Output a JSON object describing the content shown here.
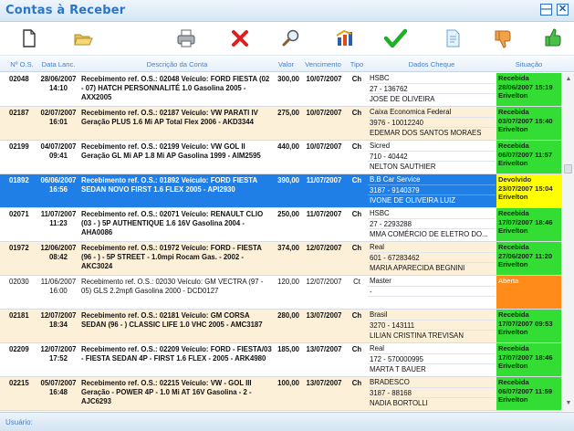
{
  "window": {
    "title": "Contas à Receber",
    "minimize": "—",
    "close": "✕"
  },
  "toolbar": [
    {
      "name": "new-document-icon"
    },
    {
      "name": "open-folder-icon"
    },
    {
      "name": "printer-icon"
    },
    {
      "name": "delete-x-icon"
    },
    {
      "name": "search-magnifier-icon"
    },
    {
      "name": "report-icon"
    },
    {
      "name": "checkmark-icon"
    },
    {
      "name": "notes-icon"
    },
    {
      "name": "thumbs-down-icon"
    },
    {
      "name": "thumbs-up-icon"
    }
  ],
  "columns": {
    "os": "Nº O.S.",
    "date": "Data Lanc.",
    "desc": "Descrição da Conta",
    "val": "Valor",
    "venc": "Vencimento",
    "tipo": "Tipo",
    "cheque": "Dados Cheque",
    "situ": "Situação"
  },
  "colors": {
    "white": "#ffffff",
    "beige": "#fdf0d8",
    "selected": "#1f7fe6",
    "green": "#33dd33",
    "yellow": "#ffff00",
    "orange": "#ff8c1a"
  },
  "rows": [
    {
      "os": "02048",
      "date": "28/06/2007\n14:10",
      "desc": "Recebimento ref. O.S.: 02048 Veículo: FORD FIESTA (02 - 07) HATCH PERSONNALITÉ 1.0 Gasolina 2005 - AXX2005",
      "val": "300,00",
      "venc": "10/07/2007",
      "tipo": "Ch",
      "bank": "HSBC",
      "cheque": "27 - 136762",
      "holder": "JOSE DE OLIVEIRA",
      "situ": "Recebida\n28/06/2007 15:19\nErivelton",
      "bg": "white",
      "situColor": "green",
      "bold": true
    },
    {
      "os": "02187",
      "date": "02/07/2007\n16:01",
      "desc": "Recebimento ref. O.S.: 02187 Veículo: VW PARATI IV Geração PLUS 1.6 Mi AP Total Flex 2006 - AKD3344",
      "val": "275,00",
      "venc": "10/07/2007",
      "tipo": "Ch",
      "bank": "Caixa Economica Federal",
      "cheque": "3976 - 10012240",
      "holder": "EDEMAR DOS SANTOS MORAES",
      "situ": "Recebida\n03/07/2007 15:40\nErivelton",
      "bg": "beige",
      "situColor": "green",
      "bold": true
    },
    {
      "os": "02199",
      "date": "04/07/2007\n09:41",
      "desc": "Recebimento ref. O.S.: 02199 Veículo: VW GOL II Geração GL Mi AP 1.8 Mi AP Gasolina 1999 - AIM2595",
      "val": "440,00",
      "venc": "10/07/2007",
      "tipo": "Ch",
      "bank": "Sicred",
      "cheque": "710 - 40442",
      "holder": "NELTON SAUTHIER",
      "situ": "Recebida\n06/07/2007 11:57\nErivelton",
      "bg": "white",
      "situColor": "green",
      "bold": true
    },
    {
      "os": "01892",
      "date": "06/06/2007\n16:56",
      "desc": "Recebimento ref. O.S.: 01892 Veículo: FORD FIESTA SEDAN NOVO FIRST 1.6 FLEX 2005 - API2930",
      "val": "390,00",
      "venc": "11/07/2007",
      "tipo": "Ch",
      "bank": "B.B Car Service",
      "cheque": "3187 - 9140379",
      "holder": "IVONE DE OLIVEIRA LUIZ",
      "situ": "Devolvido\n23/07/2007 15:04\nErivelton",
      "bg": "selected",
      "situColor": "yellow",
      "bold": true
    },
    {
      "os": "02071",
      "date": "11/07/2007\n11:23",
      "desc": "Recebimento ref. O.S.: 02071 Veículo: RENAULT CLIO (03 - ) 5P AUTHENTIQUE 1.6 16V Gasolina 2004 - AHA0086",
      "val": "250,00",
      "venc": "11/07/2007",
      "tipo": "Ch",
      "bank": "HSBC",
      "cheque": "27 - 2293288",
      "holder": "MMA COMÉRCIO DE ELETRO DO...",
      "situ": "Recebida\n17/07/2007 18:46\nErivelton",
      "bg": "white",
      "situColor": "green",
      "bold": true
    },
    {
      "os": "01972",
      "date": "12/06/2007\n08:42",
      "desc": "Recebimento ref. O.S.: 01972 Veículo: FORD - FIESTA (96 - ) - 5P STREET - 1.0mpi Rocam Gas. - 2002 - AKC3024",
      "val": "374,00",
      "venc": "12/07/2007",
      "tipo": "Ch",
      "bank": "Real",
      "cheque": "601 - 67283462",
      "holder": "MARIA APARECIDA BEGNINI",
      "situ": "Recebida\n27/06/2007 11:20\nErivelton",
      "bg": "beige",
      "situColor": "green",
      "bold": true
    },
    {
      "os": "02030",
      "date": "11/06/2007\n16:00",
      "desc": "Recebimento ref. O.S.: 02030 Veículo: GM VECTRA (97 - 05) GLS 2.2mpfi Gasolina 2000 - DCD0127",
      "val": "120,00",
      "venc": "12/07/2007",
      "tipo": "Ct",
      "bank": "Master",
      "cheque": "-",
      "holder": "",
      "situ": "Aberta",
      "bg": "white",
      "situColor": "orange",
      "bold": false
    },
    {
      "os": "02181",
      "date": "12/07/2007\n18:34",
      "desc": "Recebimento ref. O.S.: 02181 Veículo: GM CORSA SEDAN (96 - ) CLASSIC LIFE 1.0 VHC 2005 - AMC3187",
      "val": "280,00",
      "venc": "13/07/2007",
      "tipo": "Ch",
      "bank": "Brasil",
      "cheque": "3270 - 143111",
      "holder": "LILIAN CRISTINA TREVISAN",
      "situ": "Recebida\n17/07/2007 09:53\nErivelton",
      "bg": "beige",
      "situColor": "green",
      "bold": true
    },
    {
      "os": "02209",
      "date": "12/07/2007\n17:52",
      "desc": "Recebimento ref. O.S.: 02209 Veículo: FORD - FIESTA/03 - FIESTA SEDAN 4P - FIRST 1.6 FLEX - 2005 - ARK4980",
      "val": "185,00",
      "venc": "13/07/2007",
      "tipo": "Ch",
      "bank": "Real",
      "cheque": "172 - 570000995",
      "holder": "MARTA T BAUER",
      "situ": "Recebida\n17/07/2007 18:46\nErivelton",
      "bg": "white",
      "situColor": "green",
      "bold": true
    },
    {
      "os": "02215",
      "date": "05/07/2007\n16:48",
      "desc": "Recebimento ref. O.S.: 02215 Veículo: VW - GOL III Geração - POWER 4P - 1.0 Mi AT 16V Gasolina - 2 - AJC6293",
      "val": "100,00",
      "venc": "13/07/2007",
      "tipo": "Ch",
      "bank": "BRADESCO",
      "cheque": "3187 - 88168",
      "holder": "NADIA BORTOLLI",
      "situ": "Recebida\n06/07/2007 11:59\nErivelton",
      "bg": "beige",
      "situColor": "green",
      "bold": true
    }
  ],
  "status": {
    "label": "Usuário:"
  }
}
